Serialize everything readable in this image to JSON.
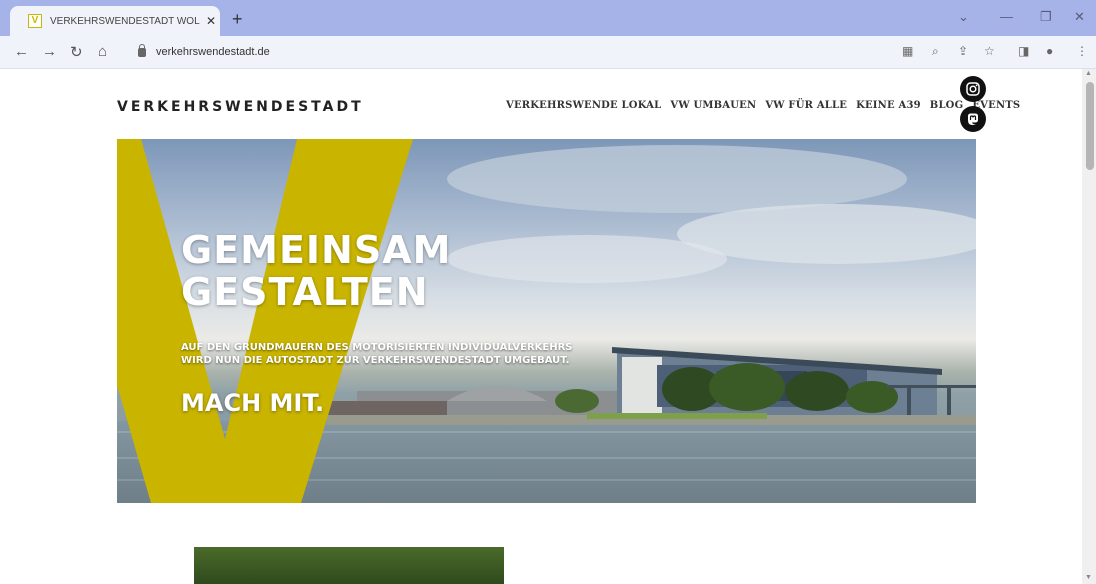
{
  "browser": {
    "tab_title": "VERKEHRSWENDESTADT WOLFS",
    "tab_favicon": "V",
    "url": "verkehrswendestadt.de"
  },
  "site": {
    "logo": "VERKEHRSWENDESTADT",
    "nav": [
      "VERKEHRSWENDE LOKAL",
      "VW UMBAUEN",
      "VW FÜR ALLE",
      "KEINE A39",
      "BLOG",
      "EVENTS"
    ],
    "social": [
      "instagram-icon",
      "mastodon-icon"
    ]
  },
  "hero": {
    "title_line1": "GEMEINSAM",
    "title_line2": "GESTALTEN",
    "subtitle_line1": "AUF DEN GRUNDMAUERN DES MOTORISIERTEN INDIVIDUALVERKEHRS",
    "subtitle_line2": "WIRD NUN DIE AUTOSTADT ZUR VERKEHRSWENDESTADT UMGEBAUT.",
    "cta": "MACH MIT.",
    "accent_color": "#c9b400"
  }
}
